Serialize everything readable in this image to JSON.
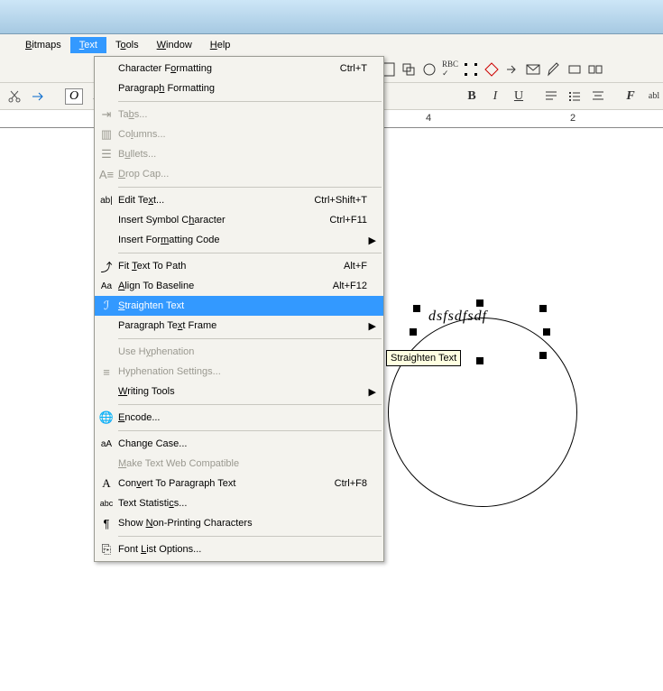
{
  "menubar": {
    "bitmaps": "Bitmaps",
    "text": "Text",
    "tools": "Tools",
    "window": "Window",
    "help": "Help"
  },
  "ruler": {
    "t4": "4",
    "t2": "2"
  },
  "canvas": {
    "text_on_path": "dsfsdfsdf"
  },
  "tooltip": "Straighten Text",
  "menu": {
    "char_fmt": "Character Formatting",
    "char_fmt_sc": "Ctrl+T",
    "para_fmt": "Paragraph Formatting",
    "tabs": "Tabs...",
    "columns": "Columns...",
    "bullets": "Bullets...",
    "dropcap": "Drop Cap...",
    "edit_text": "Edit Text...",
    "edit_text_sc": "Ctrl+Shift+T",
    "insert_symbol": "Insert Symbol Character",
    "insert_symbol_sc": "Ctrl+F11",
    "insert_fmt_code": "Insert Formatting Code",
    "fit_path": "Fit Text To Path",
    "fit_path_sc": "Alt+F",
    "align_baseline": "Align To Baseline",
    "align_baseline_sc": "Alt+F12",
    "straighten": "Straighten Text",
    "para_frame": "Paragraph Text Frame",
    "use_hyphen": "Use Hyphenation",
    "hyphen_settings": "Hyphenation Settings...",
    "writing_tools": "Writing Tools",
    "encode": "Encode...",
    "change_case": "Change Case...",
    "web_compat": "Make Text Web Compatible",
    "convert_para": "Convert To Paragraph Text",
    "convert_para_sc": "Ctrl+F8",
    "text_stats": "Text Statistics...",
    "nonprint": "Show Non-Printing Characters",
    "font_list": "Font List Options..."
  }
}
